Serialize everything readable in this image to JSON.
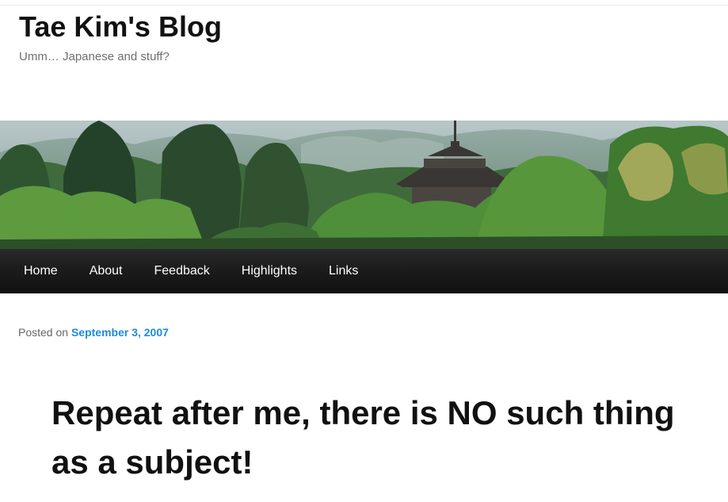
{
  "site": {
    "title": "Tae Kim's Blog",
    "tagline": "Umm… Japanese and stuff?"
  },
  "header_image": {
    "description_icon": "pagoda-forest-banner"
  },
  "nav": {
    "items": [
      {
        "label": "Home"
      },
      {
        "label": "About"
      },
      {
        "label": "Feedback"
      },
      {
        "label": "Highlights"
      },
      {
        "label": "Links"
      }
    ]
  },
  "post": {
    "posted_prefix": "Posted on",
    "date": "September 3, 2007",
    "title": "Repeat after me, there is NO such thing as a subject!"
  },
  "colors": {
    "link": "#1b8be0",
    "nav_bg": "#1c1c1c",
    "title": "#111111"
  }
}
